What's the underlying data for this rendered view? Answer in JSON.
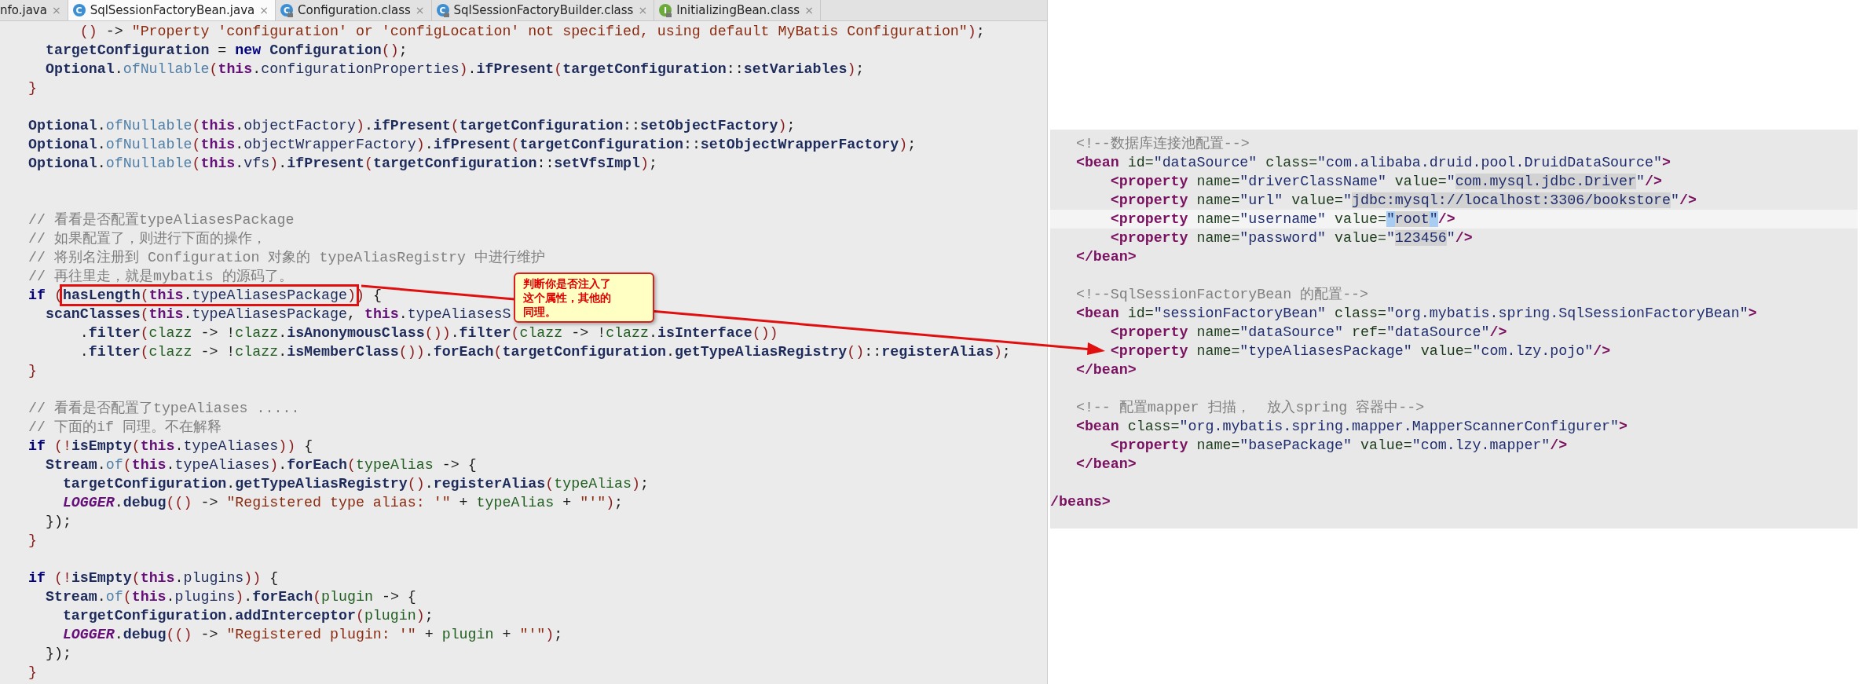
{
  "tabs": [
    {
      "label": "nfo.java",
      "close": "×",
      "selected": false
    },
    {
      "label": "SqlSessionFactoryBean.java",
      "close": "×",
      "selected": true,
      "icon_letter": "C",
      "color": "#3d8fd4",
      "locked": false
    },
    {
      "label": "Configuration.class",
      "close": "×",
      "selected": false,
      "icon_letter": "C",
      "color": "#3d8fd4",
      "locked": true
    },
    {
      "label": "SqlSessionFactoryBuilder.class",
      "close": "×",
      "selected": false,
      "icon_letter": "C",
      "color": "#3d8fd4",
      "locked": true
    },
    {
      "label": "InitializingBean.class",
      "close": "×",
      "selected": false,
      "icon_letter": "I",
      "color": "#6aab3c",
      "locked": true
    }
  ],
  "java_code": [
    {
      "kind": "code",
      "segments": [
        {
          "kind": "paren",
          "text": "      ()"
        },
        {
          "kind": "plain",
          "text": " -> "
        },
        {
          "kind": "string",
          "text": "\"Property 'configuration' or 'configLocation' not specified, using default MyBatis Configuration\""
        },
        {
          "kind": "paren",
          "text": ")"
        },
        {
          "kind": "plain",
          "text": ";"
        }
      ]
    },
    {
      "kind": "code",
      "segments": [
        {
          "kind": "ident",
          "text": "  targetConfiguration"
        },
        {
          "kind": "plain",
          "text": " = "
        },
        {
          "kind": "keyword",
          "text": "new"
        },
        {
          "kind": "ident",
          "text": " Configuration"
        },
        {
          "kind": "paren",
          "text": "()"
        },
        {
          "kind": "plain",
          "text": ";"
        }
      ]
    },
    {
      "kind": "code",
      "segments": [
        {
          "kind": "ident",
          "text": "  Optional"
        },
        {
          "kind": "plain",
          "text": "."
        },
        {
          "kind": "static",
          "text": "ofNullable"
        },
        {
          "kind": "paren",
          "text": "("
        },
        {
          "kind": "this",
          "text": "this"
        },
        {
          "kind": "plain",
          "text": "."
        },
        {
          "kind": "field",
          "text": "configurationProperties"
        },
        {
          "kind": "paren",
          "text": ")"
        },
        {
          "kind": "plain",
          "text": "."
        },
        {
          "kind": "ident",
          "text": "ifPresent"
        },
        {
          "kind": "paren",
          "text": "("
        },
        {
          "kind": "ident",
          "text": "targetConfiguration"
        },
        {
          "kind": "plain",
          "text": "::"
        },
        {
          "kind": "ident",
          "text": "setVariables"
        },
        {
          "kind": "paren",
          "text": ")"
        },
        {
          "kind": "plain",
          "text": ";"
        }
      ]
    },
    {
      "kind": "code",
      "segments": [
        {
          "kind": "paren",
          "text": "}"
        }
      ]
    },
    {
      "kind": "blank"
    },
    {
      "kind": "code",
      "segments": [
        {
          "kind": "ident",
          "text": "Optional"
        },
        {
          "kind": "plain",
          "text": "."
        },
        {
          "kind": "static",
          "text": "ofNullable"
        },
        {
          "kind": "paren",
          "text": "("
        },
        {
          "kind": "this",
          "text": "this"
        },
        {
          "kind": "plain",
          "text": "."
        },
        {
          "kind": "field",
          "text": "objectFactory"
        },
        {
          "kind": "paren",
          "text": ")"
        },
        {
          "kind": "plain",
          "text": "."
        },
        {
          "kind": "ident",
          "text": "ifPresent"
        },
        {
          "kind": "paren",
          "text": "("
        },
        {
          "kind": "ident",
          "text": "targetConfiguration"
        },
        {
          "kind": "plain",
          "text": "::"
        },
        {
          "kind": "ident",
          "text": "setObjectFactory"
        },
        {
          "kind": "paren",
          "text": ")"
        },
        {
          "kind": "plain",
          "text": ";"
        }
      ]
    },
    {
      "kind": "code",
      "segments": [
        {
          "kind": "ident",
          "text": "Optional"
        },
        {
          "kind": "plain",
          "text": "."
        },
        {
          "kind": "static",
          "text": "ofNullable"
        },
        {
          "kind": "paren",
          "text": "("
        },
        {
          "kind": "this",
          "text": "this"
        },
        {
          "kind": "plain",
          "text": "."
        },
        {
          "kind": "field",
          "text": "objectWrapperFactory"
        },
        {
          "kind": "paren",
          "text": ")"
        },
        {
          "kind": "plain",
          "text": "."
        },
        {
          "kind": "ident",
          "text": "ifPresent"
        },
        {
          "kind": "paren",
          "text": "("
        },
        {
          "kind": "ident",
          "text": "targetConfiguration"
        },
        {
          "kind": "plain",
          "text": "::"
        },
        {
          "kind": "ident",
          "text": "setObjectWrapperFactory"
        },
        {
          "kind": "paren",
          "text": ")"
        },
        {
          "kind": "plain",
          "text": ";"
        }
      ]
    },
    {
      "kind": "code",
      "segments": [
        {
          "kind": "ident",
          "text": "Optional"
        },
        {
          "kind": "plain",
          "text": "."
        },
        {
          "kind": "static",
          "text": "ofNullable"
        },
        {
          "kind": "paren",
          "text": "("
        },
        {
          "kind": "this",
          "text": "this"
        },
        {
          "kind": "plain",
          "text": "."
        },
        {
          "kind": "field",
          "text": "vfs"
        },
        {
          "kind": "paren",
          "text": ")"
        },
        {
          "kind": "plain",
          "text": "."
        },
        {
          "kind": "ident",
          "text": "ifPresent"
        },
        {
          "kind": "paren",
          "text": "("
        },
        {
          "kind": "ident",
          "text": "targetConfiguration"
        },
        {
          "kind": "plain",
          "text": "::"
        },
        {
          "kind": "ident",
          "text": "setVfsImpl"
        },
        {
          "kind": "paren",
          "text": ")"
        },
        {
          "kind": "plain",
          "text": ";"
        }
      ]
    },
    {
      "kind": "blank"
    },
    {
      "kind": "blank"
    },
    {
      "kind": "code",
      "segments": [
        {
          "kind": "comment",
          "text": "// 看看是否配置typeAliasesPackage"
        }
      ]
    },
    {
      "kind": "code",
      "segments": [
        {
          "kind": "comment",
          "text": "// 如果配置了，则进行下面的操作，"
        }
      ]
    },
    {
      "kind": "code",
      "segments": [
        {
          "kind": "comment",
          "text": "// 将别名注册到 Configuration 对象的 typeAliasRegistry 中进行维护"
        }
      ]
    },
    {
      "kind": "code",
      "segments": [
        {
          "kind": "comment",
          "text": "// 再往里走，就是mybatis 的源码了。"
        }
      ]
    },
    {
      "kind": "code",
      "segments": [
        {
          "kind": "keyword",
          "text": "if"
        },
        {
          "kind": "paren",
          "text": " ("
        },
        {
          "kind": "box",
          "segments": [
            {
              "kind": "ident",
              "text": "hasLength"
            },
            {
              "kind": "paren",
              "text": "("
            },
            {
              "kind": "this",
              "text": "this"
            },
            {
              "kind": "plain",
              "text": "."
            },
            {
              "kind": "field",
              "text": "typeAliasesPackage"
            },
            {
              "kind": "paren",
              "text": ")"
            }
          ]
        },
        {
          "kind": "paren",
          "text": ")"
        },
        {
          "kind": "plain",
          "text": " {"
        }
      ]
    },
    {
      "kind": "code",
      "segments": [
        {
          "kind": "ident",
          "text": "  scanClasses"
        },
        {
          "kind": "paren",
          "text": "("
        },
        {
          "kind": "this",
          "text": "this"
        },
        {
          "kind": "plain",
          "text": "."
        },
        {
          "kind": "field",
          "text": "typeAliasesPackage"
        },
        {
          "kind": "plain",
          "text": ", "
        },
        {
          "kind": "this",
          "text": "this"
        },
        {
          "kind": "plain",
          "text": "."
        },
        {
          "kind": "field",
          "text": "typeAliasesS"
        }
      ]
    },
    {
      "kind": "code",
      "segments": [
        {
          "kind": "plain",
          "text": "      ."
        },
        {
          "kind": "ident",
          "text": "filter"
        },
        {
          "kind": "paren",
          "text": "("
        },
        {
          "kind": "param",
          "text": "clazz"
        },
        {
          "kind": "plain",
          "text": " -> !"
        },
        {
          "kind": "param",
          "text": "clazz"
        },
        {
          "kind": "plain",
          "text": "."
        },
        {
          "kind": "ident",
          "text": "isAnonymousClass"
        },
        {
          "kind": "paren",
          "text": "())"
        },
        {
          "kind": "plain",
          "text": "."
        },
        {
          "kind": "ident",
          "text": "filter"
        },
        {
          "kind": "paren",
          "text": "("
        },
        {
          "kind": "param",
          "text": "clazz"
        },
        {
          "kind": "plain",
          "text": " -> !"
        },
        {
          "kind": "param",
          "text": "clazz"
        },
        {
          "kind": "plain",
          "text": "."
        },
        {
          "kind": "ident",
          "text": "isInterface"
        },
        {
          "kind": "paren",
          "text": "())"
        }
      ]
    },
    {
      "kind": "code",
      "segments": [
        {
          "kind": "plain",
          "text": "      ."
        },
        {
          "kind": "ident",
          "text": "filter"
        },
        {
          "kind": "paren",
          "text": "("
        },
        {
          "kind": "param",
          "text": "clazz"
        },
        {
          "kind": "plain",
          "text": " -> !"
        },
        {
          "kind": "param",
          "text": "clazz"
        },
        {
          "kind": "plain",
          "text": "."
        },
        {
          "kind": "ident",
          "text": "isMemberClass"
        },
        {
          "kind": "paren",
          "text": "())"
        },
        {
          "kind": "plain",
          "text": "."
        },
        {
          "kind": "ident",
          "text": "forEach"
        },
        {
          "kind": "paren",
          "text": "("
        },
        {
          "kind": "ident",
          "text": "targetConfiguration"
        },
        {
          "kind": "plain",
          "text": "."
        },
        {
          "kind": "ident",
          "text": "getTypeAliasRegistry"
        },
        {
          "kind": "paren",
          "text": "()"
        },
        {
          "kind": "plain",
          "text": "::"
        },
        {
          "kind": "ident",
          "text": "registerAlias"
        },
        {
          "kind": "paren",
          "text": ")"
        },
        {
          "kind": "plain",
          "text": ";"
        }
      ]
    },
    {
      "kind": "code",
      "segments": [
        {
          "kind": "paren",
          "text": "}"
        }
      ]
    },
    {
      "kind": "blank"
    },
    {
      "kind": "code",
      "segments": [
        {
          "kind": "comment",
          "text": "// 看看是否配置了typeAliases ....."
        }
      ]
    },
    {
      "kind": "code",
      "segments": [
        {
          "kind": "comment",
          "text": "// 下面的if 同理。不在解释"
        }
      ]
    },
    {
      "kind": "code",
      "segments": [
        {
          "kind": "keyword",
          "text": "if"
        },
        {
          "kind": "paren",
          "text": " (!"
        },
        {
          "kind": "ident",
          "text": "isEmpty"
        },
        {
          "kind": "paren",
          "text": "("
        },
        {
          "kind": "this",
          "text": "this"
        },
        {
          "kind": "plain",
          "text": "."
        },
        {
          "kind": "field",
          "text": "typeAliases"
        },
        {
          "kind": "paren",
          "text": "))"
        },
        {
          "kind": "plain",
          "text": " {"
        }
      ]
    },
    {
      "kind": "code",
      "segments": [
        {
          "kind": "ident",
          "text": "  Stream"
        },
        {
          "kind": "plain",
          "text": "."
        },
        {
          "kind": "static",
          "text": "of"
        },
        {
          "kind": "paren",
          "text": "("
        },
        {
          "kind": "this",
          "text": "this"
        },
        {
          "kind": "plain",
          "text": "."
        },
        {
          "kind": "field",
          "text": "typeAliases"
        },
        {
          "kind": "paren",
          "text": ")"
        },
        {
          "kind": "plain",
          "text": "."
        },
        {
          "kind": "ident",
          "text": "forEach"
        },
        {
          "kind": "paren",
          "text": "("
        },
        {
          "kind": "param",
          "text": "typeAlias"
        },
        {
          "kind": "plain",
          "text": " -> {"
        }
      ]
    },
    {
      "kind": "code",
      "segments": [
        {
          "kind": "ident",
          "text": "    targetConfiguration"
        },
        {
          "kind": "plain",
          "text": "."
        },
        {
          "kind": "ident",
          "text": "getTypeAliasRegistry"
        },
        {
          "kind": "paren",
          "text": "()"
        },
        {
          "kind": "plain",
          "text": "."
        },
        {
          "kind": "ident",
          "text": "registerAlias"
        },
        {
          "kind": "paren",
          "text": "("
        },
        {
          "kind": "param",
          "text": "typeAlias"
        },
        {
          "kind": "paren",
          "text": ")"
        },
        {
          "kind": "plain",
          "text": ";"
        }
      ]
    },
    {
      "kind": "code",
      "segments": [
        {
          "kind": "constant",
          "text": "    LOGGER"
        },
        {
          "kind": "plain",
          "text": "."
        },
        {
          "kind": "ident",
          "text": "debug"
        },
        {
          "kind": "paren",
          "text": "(()"
        },
        {
          "kind": "plain",
          "text": " -> "
        },
        {
          "kind": "string",
          "text": "\"Registered type alias: '\""
        },
        {
          "kind": "plain",
          "text": " + "
        },
        {
          "kind": "param",
          "text": "typeAlias"
        },
        {
          "kind": "plain",
          "text": " + "
        },
        {
          "kind": "string",
          "text": "\"'\""
        },
        {
          "kind": "paren",
          "text": ")"
        },
        {
          "kind": "plain",
          "text": ";"
        }
      ]
    },
    {
      "kind": "code",
      "segments": [
        {
          "kind": "plain",
          "text": "  });"
        }
      ]
    },
    {
      "kind": "code",
      "segments": [
        {
          "kind": "paren",
          "text": "}"
        }
      ]
    },
    {
      "kind": "blank"
    },
    {
      "kind": "code",
      "segments": [
        {
          "kind": "keyword",
          "text": "if"
        },
        {
          "kind": "paren",
          "text": " (!"
        },
        {
          "kind": "ident",
          "text": "isEmpty"
        },
        {
          "kind": "paren",
          "text": "("
        },
        {
          "kind": "this",
          "text": "this"
        },
        {
          "kind": "plain",
          "text": "."
        },
        {
          "kind": "field",
          "text": "plugins"
        },
        {
          "kind": "paren",
          "text": "))"
        },
        {
          "kind": "plain",
          "text": " {"
        }
      ]
    },
    {
      "kind": "code",
      "segments": [
        {
          "kind": "ident",
          "text": "  Stream"
        },
        {
          "kind": "plain",
          "text": "."
        },
        {
          "kind": "static",
          "text": "of"
        },
        {
          "kind": "paren",
          "text": "("
        },
        {
          "kind": "this",
          "text": "this"
        },
        {
          "kind": "plain",
          "text": "."
        },
        {
          "kind": "field",
          "text": "plugins"
        },
        {
          "kind": "paren",
          "text": ")"
        },
        {
          "kind": "plain",
          "text": "."
        },
        {
          "kind": "ident",
          "text": "forEach"
        },
        {
          "kind": "paren",
          "text": "("
        },
        {
          "kind": "param",
          "text": "plugin"
        },
        {
          "kind": "plain",
          "text": " -> {"
        }
      ]
    },
    {
      "kind": "code",
      "segments": [
        {
          "kind": "ident",
          "text": "    targetConfiguration"
        },
        {
          "kind": "plain",
          "text": "."
        },
        {
          "kind": "ident",
          "text": "addInterceptor"
        },
        {
          "kind": "paren",
          "text": "("
        },
        {
          "kind": "param",
          "text": "plugin"
        },
        {
          "kind": "paren",
          "text": ")"
        },
        {
          "kind": "plain",
          "text": ";"
        }
      ]
    },
    {
      "kind": "code",
      "segments": [
        {
          "kind": "constant",
          "text": "    LOGGER"
        },
        {
          "kind": "plain",
          "text": "."
        },
        {
          "kind": "ident",
          "text": "debug"
        },
        {
          "kind": "paren",
          "text": "(()"
        },
        {
          "kind": "plain",
          "text": " -> "
        },
        {
          "kind": "string",
          "text": "\"Registered plugin: '\""
        },
        {
          "kind": "plain",
          "text": " + "
        },
        {
          "kind": "param",
          "text": "plugin"
        },
        {
          "kind": "plain",
          "text": " + "
        },
        {
          "kind": "string",
          "text": "\"'\""
        },
        {
          "kind": "paren",
          "text": ")"
        },
        {
          "kind": "plain",
          "text": ";"
        }
      ]
    },
    {
      "kind": "code",
      "segments": [
        {
          "kind": "plain",
          "text": "  });"
        }
      ]
    },
    {
      "kind": "code",
      "segments": [
        {
          "kind": "paren",
          "text": "}"
        }
      ]
    }
  ],
  "callout": {
    "lines": [
      "判断你是否注入了",
      "这个属性，其他的",
      "同理。"
    ]
  },
  "xml_code": [
    {
      "kind": "code",
      "current": false,
      "segments": [
        {
          "kind": "comment",
          "text": "   <!--数据库连接池配置-->"
        }
      ]
    },
    {
      "kind": "code",
      "current": false,
      "segments": [
        {
          "kind": "tag",
          "text": "   <bean"
        },
        {
          "kind": "attr",
          "text": " id="
        },
        {
          "kind": "value",
          "text": "\"dataSource\""
        },
        {
          "kind": "attr",
          "text": " class="
        },
        {
          "kind": "value",
          "text": "\"com.alibaba.druid.pool.DruidDataSource\""
        },
        {
          "kind": "tag",
          "text": ">"
        }
      ]
    },
    {
      "kind": "code",
      "current": false,
      "segments": [
        {
          "kind": "tag",
          "text": "       <property"
        },
        {
          "kind": "attr",
          "text": " name="
        },
        {
          "kind": "value",
          "text": "\"driverClassName\""
        },
        {
          "kind": "attr",
          "text": " value="
        },
        {
          "kind": "value",
          "text": "\""
        },
        {
          "kind": "value-mark",
          "text": "com.mysql.jdbc.Driver"
        },
        {
          "kind": "value",
          "text": "\""
        },
        {
          "kind": "tag",
          "text": "/>"
        }
      ]
    },
    {
      "kind": "code",
      "current": false,
      "segments": [
        {
          "kind": "tag",
          "text": "       <property"
        },
        {
          "kind": "attr",
          "text": " name="
        },
        {
          "kind": "value",
          "text": "\"url\""
        },
        {
          "kind": "attr",
          "text": " value="
        },
        {
          "kind": "value",
          "text": "\""
        },
        {
          "kind": "value-mark",
          "text": "jdbc:mysql://localhost:3306/bookstore"
        },
        {
          "kind": "value",
          "text": "\""
        },
        {
          "kind": "tag",
          "text": "/>"
        }
      ]
    },
    {
      "kind": "code",
      "current": true,
      "segments": [
        {
          "kind": "tag",
          "text": "       <property"
        },
        {
          "kind": "attr",
          "text": " name="
        },
        {
          "kind": "value",
          "text": "\"username\""
        },
        {
          "kind": "attr",
          "text": " value="
        },
        {
          "kind": "quote-mark",
          "text": "\""
        },
        {
          "kind": "value-mark",
          "text": "root"
        },
        {
          "kind": "quote-mark",
          "text": "\""
        },
        {
          "kind": "tag",
          "text": "/>"
        }
      ]
    },
    {
      "kind": "code",
      "current": false,
      "segments": [
        {
          "kind": "tag",
          "text": "       <property"
        },
        {
          "kind": "attr",
          "text": " name="
        },
        {
          "kind": "value",
          "text": "\"password\""
        },
        {
          "kind": "attr",
          "text": " value="
        },
        {
          "kind": "value",
          "text": "\""
        },
        {
          "kind": "value-mark",
          "text": "123456"
        },
        {
          "kind": "value",
          "text": "\""
        },
        {
          "kind": "tag",
          "text": "/>"
        }
      ]
    },
    {
      "kind": "code",
      "current": false,
      "segments": [
        {
          "kind": "tag",
          "text": "   </bean>"
        }
      ]
    },
    {
      "kind": "blank",
      "current": false
    },
    {
      "kind": "code",
      "current": false,
      "segments": [
        {
          "kind": "comment",
          "text": "   <!--SqlSessionFactoryBean 的配置-->"
        }
      ]
    },
    {
      "kind": "code",
      "current": false,
      "segments": [
        {
          "kind": "tag",
          "text": "   <bean"
        },
        {
          "kind": "attr",
          "text": " id="
        },
        {
          "kind": "value",
          "text": "\"sessionFactoryBean\""
        },
        {
          "kind": "attr",
          "text": " class="
        },
        {
          "kind": "value",
          "text": "\"org.mybatis.spring.SqlSessionFactoryBean\""
        },
        {
          "kind": "tag",
          "text": ">"
        }
      ]
    },
    {
      "kind": "code",
      "current": false,
      "segments": [
        {
          "kind": "tag",
          "text": "       <property"
        },
        {
          "kind": "attr",
          "text": " name="
        },
        {
          "kind": "value",
          "text": "\"dataSource\""
        },
        {
          "kind": "attr",
          "text": " ref="
        },
        {
          "kind": "value",
          "text": "\"dataSource\""
        },
        {
          "kind": "tag",
          "text": "/>"
        }
      ]
    },
    {
      "kind": "code",
      "current": false,
      "segments": [
        {
          "kind": "tag",
          "text": "       <property"
        },
        {
          "kind": "attr",
          "text": " name="
        },
        {
          "kind": "value",
          "text": "\"typeAliasesPackage\""
        },
        {
          "kind": "attr",
          "text": " value="
        },
        {
          "kind": "value",
          "text": "\"com.lzy.pojo\""
        },
        {
          "kind": "tag",
          "text": "/>"
        }
      ]
    },
    {
      "kind": "code",
      "current": false,
      "segments": [
        {
          "kind": "tag",
          "text": "   </bean>"
        }
      ]
    },
    {
      "kind": "blank",
      "current": false
    },
    {
      "kind": "code",
      "current": false,
      "segments": [
        {
          "kind": "comment",
          "text": "   <!-- 配置mapper 扫描，  放入spring 容器中-->"
        }
      ]
    },
    {
      "kind": "code",
      "current": false,
      "segments": [
        {
          "kind": "tag",
          "text": "   <bean"
        },
        {
          "kind": "attr",
          "text": " class="
        },
        {
          "kind": "value",
          "text": "\"org.mybatis.spring.mapper.MapperScannerConfigurer\""
        },
        {
          "kind": "tag",
          "text": ">"
        }
      ]
    },
    {
      "kind": "code",
      "current": false,
      "segments": [
        {
          "kind": "tag",
          "text": "       <property"
        },
        {
          "kind": "attr",
          "text": " name="
        },
        {
          "kind": "value",
          "text": "\"basePackage\""
        },
        {
          "kind": "attr",
          "text": " value="
        },
        {
          "kind": "value",
          "text": "\"com.lzy.mapper\""
        },
        {
          "kind": "tag",
          "text": "/>"
        }
      ]
    },
    {
      "kind": "code",
      "current": false,
      "segments": [
        {
          "kind": "tag",
          "text": "   </bean>"
        }
      ]
    },
    {
      "kind": "blank",
      "current": false
    },
    {
      "kind": "code",
      "current": false,
      "segments": [
        {
          "kind": "tag",
          "text": "/beans>"
        }
      ]
    }
  ]
}
